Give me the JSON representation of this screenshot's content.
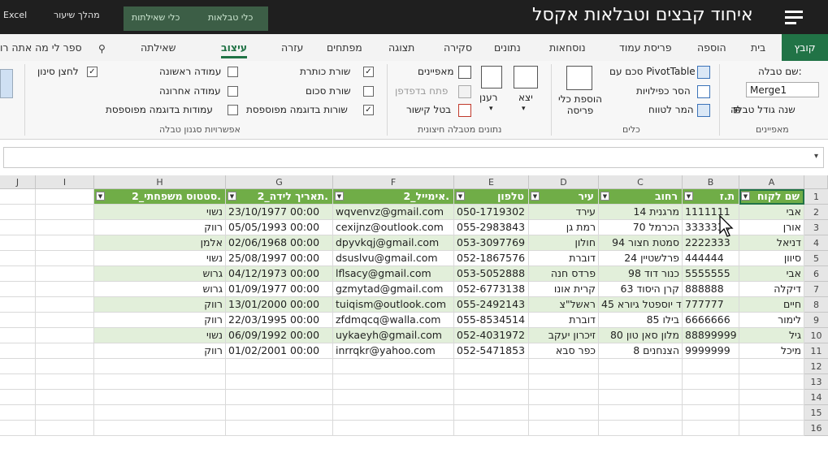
{
  "titlebar": {
    "app": "Excel",
    "lesson": "מהלך שיעור",
    "context_queries": "כלי שאילתות",
    "context_tables": "כלי טבלאות",
    "video_title": "איחוד קבצים וטבלאות אקסל"
  },
  "tabs": {
    "file": "קובץ",
    "home": "בית",
    "insert": "הוספה",
    "page_layout": "פריסת עמוד",
    "formulas": "נוסחאות",
    "data": "נתונים",
    "review": "סקירה",
    "view": "תצוגה",
    "developer": "מפתחים",
    "help": "עזרה",
    "design": "עיצוב",
    "query": "שאילתה",
    "tell_me": "ספר לי מה אתה רו"
  },
  "ribbon": {
    "properties": {
      "table_name_label": "שם טבלה:",
      "table_name_value": "Merge1",
      "resize": "שנה גודל טבלה",
      "group": "מאפיינים"
    },
    "tools": {
      "pivot": "סכם עם PivotTable",
      "remove_dup": "הסר כפילויות",
      "convert_range": "המר לטווח",
      "slicer": "הוספת כלי פריסה",
      "group": "כלים"
    },
    "external": {
      "export": "יצא",
      "refresh": "רענן",
      "properties": "מאפיינים",
      "open_browser": "פתח בדפדפן",
      "unlink": "בטל קישור",
      "group": "נתונים מטבלה חיצונית"
    },
    "style_options": {
      "header_row": "שורת כותרת",
      "total_row": "שורת סכום",
      "banded_rows": "שורות בדוגמה מפוספסת",
      "first_column": "עמודה ראשונה",
      "last_column": "עמודה אחרונה",
      "banded_columns": "עמודות בדוגמה מפוספסת",
      "filter_button": "לחצן סינון",
      "group": "אפשרויות סגנון טבלה",
      "checked": {
        "header_row": true,
        "total_row": false,
        "banded_rows": true,
        "first_column": false,
        "last_column": false,
        "banded_columns": false,
        "filter_button": true
      }
    }
  },
  "grid": {
    "col_letters": [
      "A",
      "B",
      "C",
      "D",
      "E",
      "F",
      "G",
      "H",
      "I",
      "J"
    ],
    "row_numbers": [
      "1",
      "2",
      "3",
      "4",
      "5",
      "6",
      "7",
      "8",
      "9",
      "10",
      "11",
      "12",
      "13",
      "14",
      "15",
      "16"
    ],
    "headers": [
      "שם לקוח",
      "ת.ז",
      "רחוב",
      "עיר",
      "טלפון",
      "אימייל_2.",
      "תאריך לידה_2.",
      "סטטוס משפחתי_2."
    ],
    "rows": [
      [
        "אבי",
        "1111111",
        "מרגנית 14",
        "עירד",
        "050-1719302",
        "wqvenvz@gmail.com",
        "23/10/1977 00:00",
        "נשוי"
      ],
      [
        "אורן",
        "3333333",
        "הכרמל 70",
        "רמת גן",
        "055-2983843",
        "cexijnz@outlook.com",
        "05/05/1993 00:00",
        "רווק"
      ],
      [
        "דניאל",
        "2222333",
        "סמטת חצור 94",
        "חולון",
        "053-3097769",
        "dpyvkqj@gmail.com",
        "02/06/1968 00:00",
        "אלמן"
      ],
      [
        "סיוון",
        "444444",
        "פרלשטיין 24",
        "דוברת",
        "052-1867576",
        "dsuslvu@gmail.com",
        "25/08/1997 00:00",
        "נשוי"
      ],
      [
        "אבי",
        "5555555",
        "כנור דוד 98",
        "פרדס חנה",
        "053-5052888",
        "lflsacy@gmail.com",
        "04/12/1973 00:00",
        "גרוש"
      ],
      [
        "דיקלה",
        "888888",
        "קרן היסוד 63",
        "קרית אונו",
        "052-6773138",
        "gzmytad@gmail.com",
        "01/09/1977 00:00",
        "גרוש"
      ],
      [
        "חיים",
        "777777",
        "שד יוספטל גיורא 45",
        "ראשל\"צ",
        "055-2492143",
        "tuiqism@outlook.com",
        "13/01/2000 00:00",
        "רווק"
      ],
      [
        "לימור",
        "6666666",
        "בילו 85",
        "דוברת",
        "055-8534514",
        "zfdmqcq@walla.com",
        "22/03/1995 00:00",
        "רווק"
      ],
      [
        "גיל",
        "88899999",
        "מלון סאן טון 80",
        "זיכרון יעקב",
        "052-4031972",
        "uykaeyh@gmail.com",
        "06/09/1992 00:00",
        "נשוי"
      ],
      [
        "מיכל",
        "9999999",
        "הצנחנים 8",
        "כפר סבא",
        "052-5471853",
        "inrrqkr@yahoo.com",
        "01/02/2001 00:00",
        "רווק"
      ]
    ]
  }
}
